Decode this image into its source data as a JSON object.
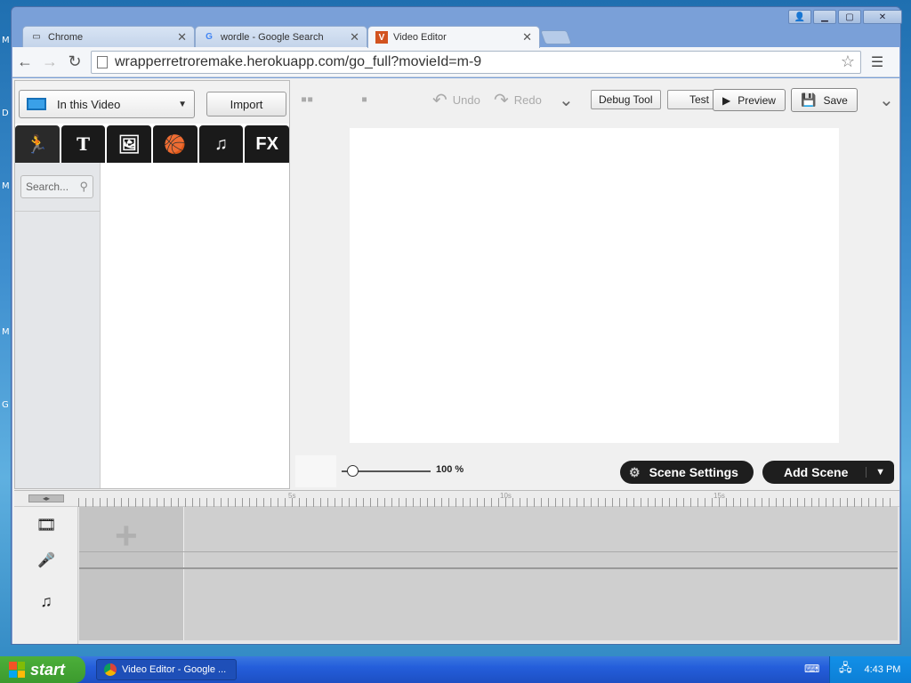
{
  "desktop": {
    "letters": [
      "M",
      "D",
      "M",
      "M",
      "G"
    ]
  },
  "browser": {
    "tabs": [
      {
        "label": "Chrome",
        "icon": "page-icon"
      },
      {
        "label": "wordle - Google Search",
        "icon": "google-icon"
      },
      {
        "label": "Video Editor",
        "icon": "v-favicon",
        "active": true
      }
    ],
    "url": "wrapperretroremake.herokuapp.com/go_full?movieId=m-9"
  },
  "leftpanel": {
    "dropdown_label": "In this Video",
    "import_label": "Import",
    "category_tabs": [
      {
        "name": "characters",
        "glyph": "🏃"
      },
      {
        "name": "text",
        "glyph": "T"
      },
      {
        "name": "backgrounds",
        "glyph": "🖼"
      },
      {
        "name": "props",
        "glyph": "🏀"
      },
      {
        "name": "music",
        "glyph": "♫"
      },
      {
        "name": "fx",
        "glyph": "FX"
      }
    ],
    "search_placeholder": "Search..."
  },
  "editor": {
    "undo_label": "Undo",
    "redo_label": "Redo",
    "debug_label": "Debug Tool",
    "test_label": "Test",
    "preview_label": "Preview",
    "save_label": "Save",
    "zoom_value": "100 %",
    "zoom_level": 0.12,
    "scene_settings_label": "Scene Settings",
    "add_scene_label": "Add Scene"
  },
  "timeline": {
    "ruler_labels": [
      "5s",
      "10s",
      "15s"
    ]
  },
  "taskbar": {
    "start_label": "start",
    "task_label": "Video Editor - Google ...",
    "clock": "4:43 PM"
  },
  "colors": {
    "accent_dark": "#1e1e1e",
    "taskbar_blue": "#245edb",
    "start_green": "#3c9a2e"
  }
}
